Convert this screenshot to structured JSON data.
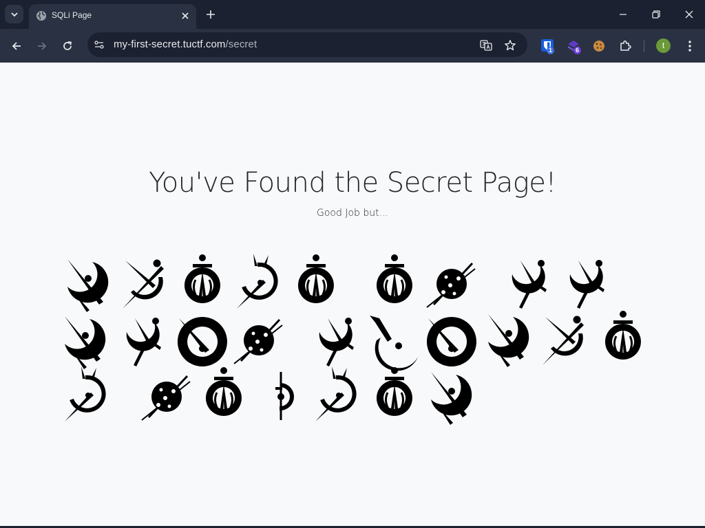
{
  "browser": {
    "tab_title": "SQLi Page",
    "url_host": "my-first-secret.tuctf.com",
    "url_path": "/secret",
    "extensions": [
      {
        "name": "bitwarden-icon",
        "badge": "1"
      },
      {
        "name": "stack-icon",
        "badge": "6"
      },
      {
        "name": "cookie-icon"
      },
      {
        "name": "puzzle-icon"
      }
    ],
    "profile_initial": "t"
  },
  "page": {
    "heading": "You've Found the Secret Page!",
    "subheading": "Good Job but..."
  },
  "colors": {
    "chrome_dark": "#1b2130",
    "chrome_mid": "#2a3142",
    "page_bg": "#f8f9fa",
    "text": "#212529",
    "badge_blue": "#3c6ee0",
    "badge_purple": "#6a3fd6",
    "avatar_green": "#6b9a3a"
  }
}
